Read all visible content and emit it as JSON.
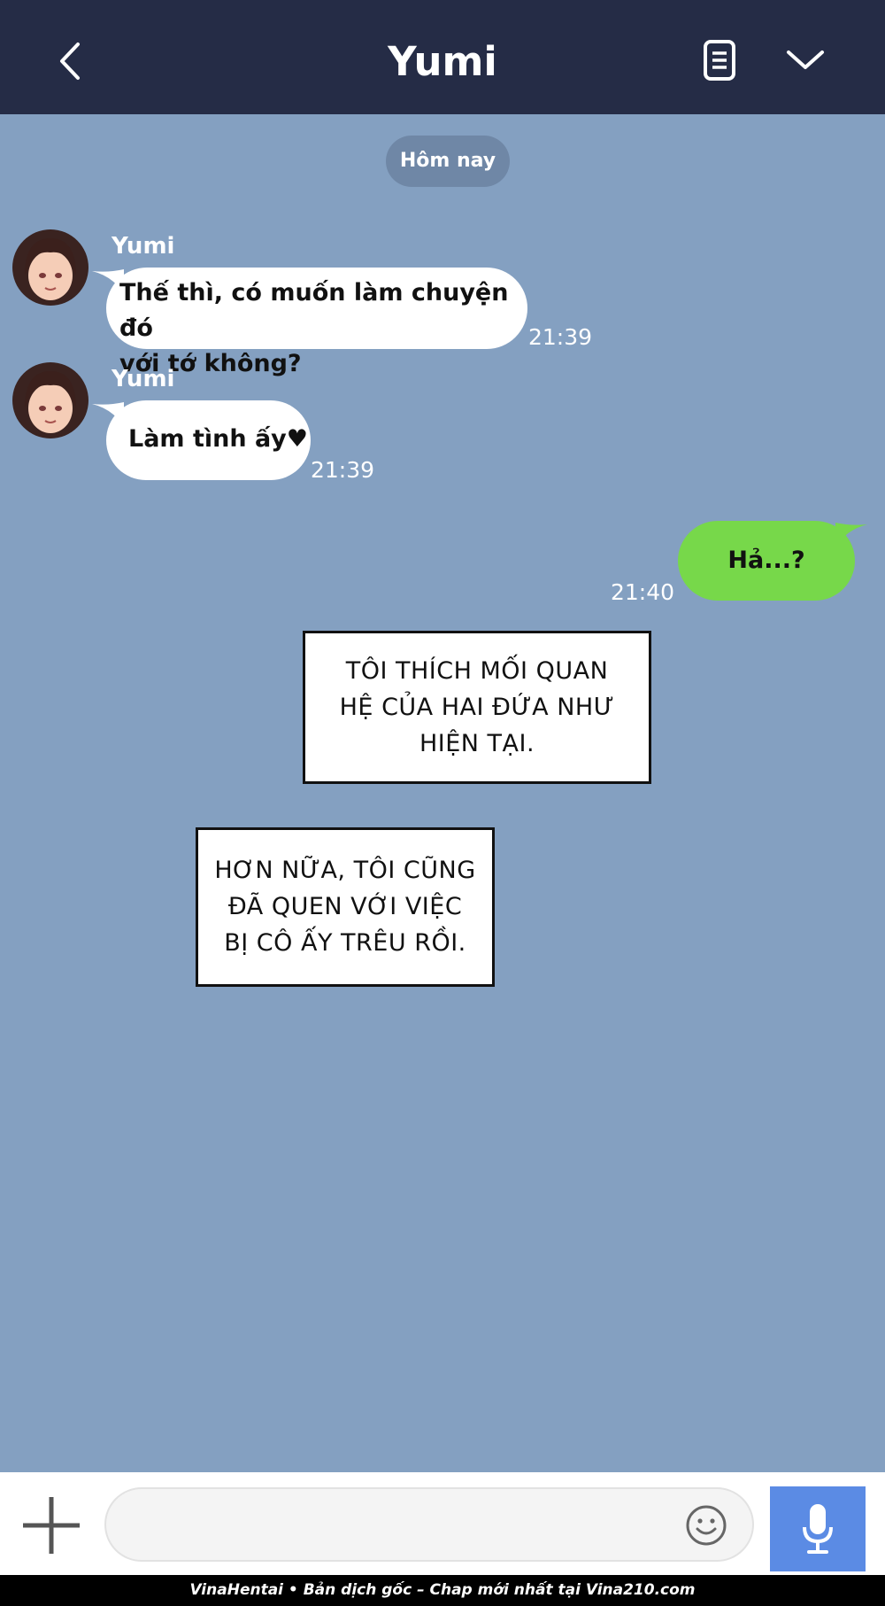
{
  "header": {
    "title": "Yumi",
    "back_icon": "chevron-left-icon",
    "notes_icon": "notes-icon",
    "menu_icon": "chevron-down-icon",
    "background": "#252c46"
  },
  "chat": {
    "background": "#84a0c1",
    "date_label": "Hôm nay",
    "messages": [
      {
        "sender": "Yumi",
        "lines": [
          "Thế thì, có muốn làm chuyện đó",
          "với tớ không?"
        ],
        "time": "21:39",
        "direction": "incoming"
      },
      {
        "sender": "Yumi",
        "lines": [
          "Làm tình ấy♥"
        ],
        "time": "21:39",
        "direction": "incoming"
      },
      {
        "lines": [
          "Hả...?"
        ],
        "time": "21:40",
        "direction": "outgoing",
        "color": "#77d84a"
      }
    ],
    "captions": [
      [
        "TÔI THÍCH MỐI QUAN",
        "HỆ CỦA HAI ĐỨA NHƯ",
        "HIỆN TẠI."
      ],
      [
        "HƠN NỮA, TÔI CŨNG",
        "ĐÃ QUEN VỚI VIỆC",
        "BỊ CÔ ẤY TRÊU RỒI."
      ]
    ]
  },
  "input_bar": {
    "plus_icon": "plus-icon",
    "message_placeholder": "",
    "emoji_icon": "smiley-icon",
    "mic_icon": "microphone-icon",
    "mic_color": "#5b8be4"
  },
  "footer": {
    "text": "VinaHentai • Bản dịch gốc – Chap mới nhất tại Vina210.com"
  }
}
